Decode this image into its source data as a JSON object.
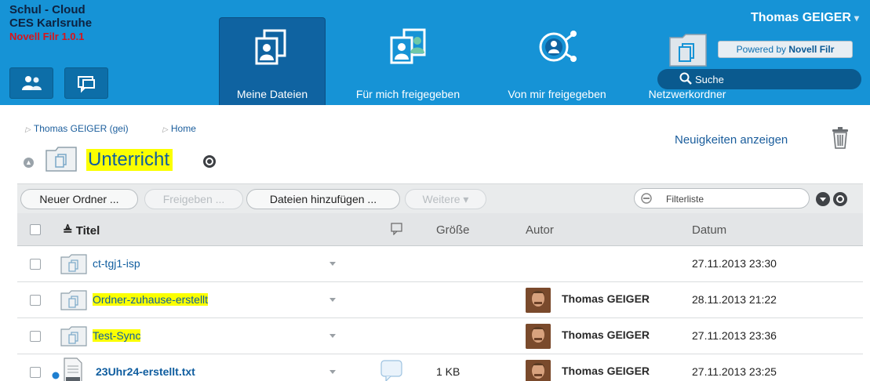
{
  "brand": {
    "line1": "Schul - Cloud",
    "line2": "CES Karlsruhe",
    "line3": "Novell Filr 1.0.1"
  },
  "nav": {
    "tabs": [
      {
        "label": "Meine Dateien",
        "icon": "my-files-icon",
        "active": true
      },
      {
        "label": "Für mich freigegeben",
        "icon": "shared-with-me-icon",
        "active": false
      },
      {
        "label": "Von mir freigegeben",
        "icon": "shared-by-me-icon",
        "active": false
      },
      {
        "label": "Netzwerkordner",
        "icon": "network-folder-icon",
        "active": false
      }
    ]
  },
  "user": {
    "name": "Thomas GEIGER",
    "powered_prefix": "Powered by ",
    "powered_brand": "Novell Filr"
  },
  "search": {
    "placeholder": "Suche"
  },
  "breadcrumb": {
    "items": [
      "Thomas GEIGER (gei)",
      "Home"
    ]
  },
  "page": {
    "title": "Unterricht",
    "news_link": "Neuigkeiten anzeigen"
  },
  "toolbar": {
    "new_folder": "Neuer Ordner ...",
    "share": "Freigeben ...",
    "add_files": "Dateien hinzufügen ...",
    "more": "Weitere"
  },
  "filter": {
    "placeholder": "Filterliste"
  },
  "table": {
    "columns": {
      "title": "Titel",
      "size": "Größe",
      "author": "Autor",
      "date": "Datum"
    },
    "rows": [
      {
        "name": "ct-tgj1-isp",
        "author": "",
        "size": "",
        "date": "27.11.2013 23:30",
        "type": "folder",
        "highlight": false
      },
      {
        "name": "Ordner-zuhause-erstellt",
        "author": "Thomas GEIGER",
        "size": "",
        "date": "28.11.2013 21:22",
        "type": "folder",
        "highlight": true
      },
      {
        "name": "Test-Sync",
        "author": "Thomas GEIGER",
        "size": "",
        "date": "27.11.2013 23:36",
        "type": "folder",
        "highlight": true
      },
      {
        "name": "23Uhr24-erstellt.txt",
        "author": "Thomas GEIGER",
        "size": "1 KB",
        "date": "27.11.2013 23:25",
        "type": "file",
        "highlight": false
      }
    ]
  },
  "colors": {
    "header_bg": "#1693d6",
    "active_tab": "#0f63a1",
    "link": "#0f5d9f",
    "highlight": "#fbff00",
    "brand_red": "#d7141b"
  }
}
